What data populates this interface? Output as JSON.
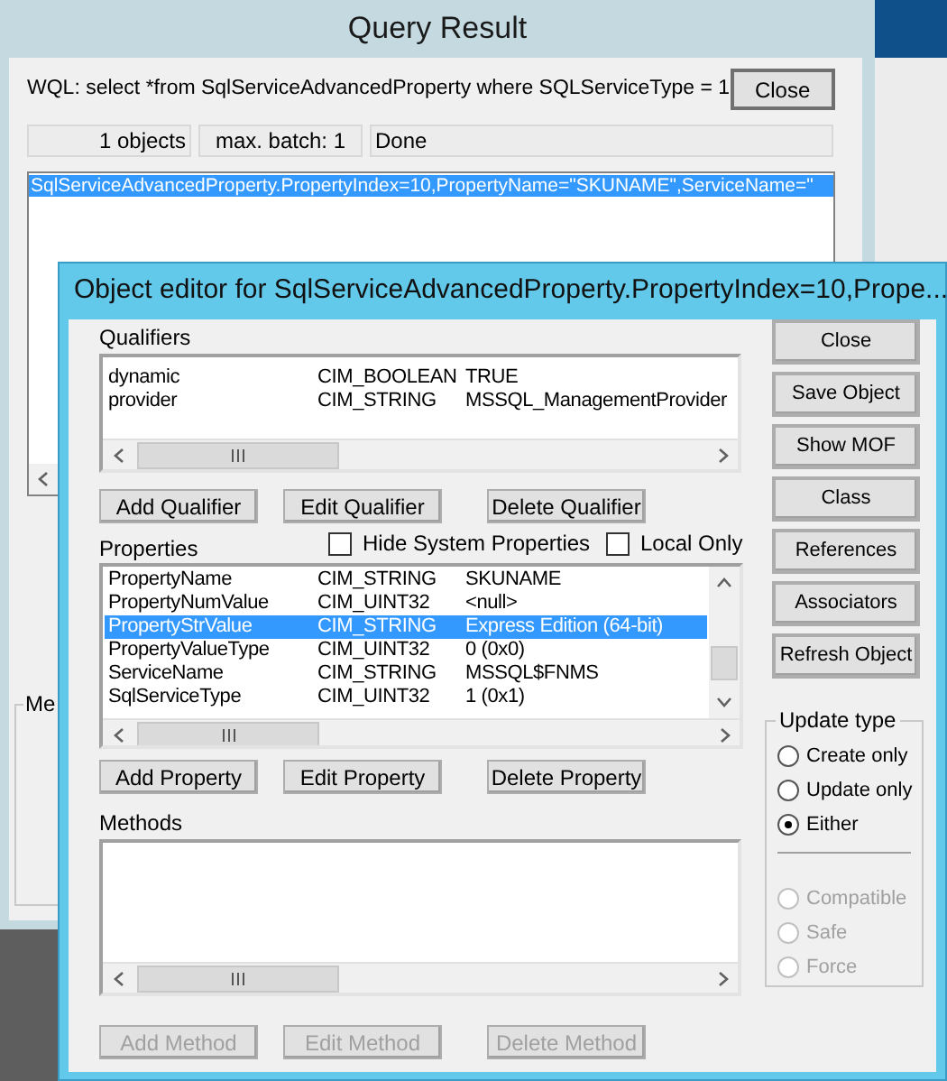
{
  "query_window": {
    "title": "Query Result",
    "query": "WQL: select *from SqlServiceAdvancedProperty where SQLServiceType = 1",
    "close_button": "Close",
    "status": [
      "1 objects",
      "max. batch: 1",
      "Done"
    ],
    "results": [
      {
        "text": "SqlServiceAdvancedProperty.PropertyIndex=10,PropertyName=\"SKUNAME\",ServiceName=\"",
        "selected": true
      }
    ],
    "group_label": "Me"
  },
  "editor": {
    "title": "Object editor for SqlServiceAdvancedProperty.PropertyIndex=10,Prope...",
    "qualifiers": {
      "label": "Qualifiers",
      "rows": [
        {
          "name": "dynamic",
          "type": "CIM_BOOLEAN",
          "value": "TRUE"
        },
        {
          "name": "provider",
          "type": "CIM_STRING",
          "value": "MSSQL_ManagementProvider"
        }
      ],
      "buttons": [
        {
          "label": "Add Qualifier",
          "disabled": false
        },
        {
          "label": "Edit Qualifier",
          "disabled": false
        },
        {
          "label": "Delete Qualifier",
          "disabled": false
        }
      ]
    },
    "properties": {
      "label": "Properties",
      "options": [
        {
          "label": "Hide System Properties",
          "checked": false
        },
        {
          "label": "Local Only",
          "checked": false
        }
      ],
      "rows": [
        {
          "name": "PropertyName",
          "type": "CIM_STRING",
          "value": "SKUNAME",
          "selected": false
        },
        {
          "name": "PropertyNumValue",
          "type": "CIM_UINT32",
          "value": "<null>",
          "selected": false
        },
        {
          "name": "PropertyStrValue",
          "type": "CIM_STRING",
          "value": "Express Edition (64-bit)",
          "selected": true
        },
        {
          "name": "PropertyValueType",
          "type": "CIM_UINT32",
          "value": "0 (0x0)",
          "selected": false
        },
        {
          "name": "ServiceName",
          "type": "CIM_STRING",
          "value": "MSSQL$FNMS",
          "selected": false
        },
        {
          "name": "SqlServiceType",
          "type": "CIM_UINT32",
          "value": "1 (0x1)",
          "selected": false
        }
      ],
      "buttons": [
        {
          "label": "Add Property",
          "disabled": false
        },
        {
          "label": "Edit Property",
          "disabled": false
        },
        {
          "label": "Delete Property",
          "disabled": false
        }
      ]
    },
    "methods": {
      "label": "Methods",
      "buttons": [
        {
          "label": "Add Method",
          "disabled": true
        },
        {
          "label": "Edit Method",
          "disabled": true
        },
        {
          "label": "Delete Method",
          "disabled": true
        }
      ]
    },
    "side_buttons": [
      {
        "label": "Close",
        "disabled": false
      },
      {
        "label": "Save Object",
        "disabled": false
      },
      {
        "label": "Show MOF",
        "disabled": false
      },
      {
        "label": "Class",
        "disabled": false
      },
      {
        "label": "References",
        "disabled": false
      },
      {
        "label": "Associators",
        "disabled": false
      },
      {
        "label": "Refresh Object",
        "disabled": false
      }
    ],
    "update_type": {
      "label": "Update type",
      "update_options": [
        {
          "label": "Create only",
          "selected": false,
          "disabled": false
        },
        {
          "label": "Update only",
          "selected": false,
          "disabled": false
        },
        {
          "label": "Either",
          "selected": true,
          "disabled": false
        }
      ],
      "mode_options": [
        {
          "label": "Compatible",
          "selected": false,
          "disabled": true
        },
        {
          "label": "Safe",
          "selected": false,
          "disabled": true
        },
        {
          "label": "Force",
          "selected": false,
          "disabled": true
        }
      ]
    }
  }
}
